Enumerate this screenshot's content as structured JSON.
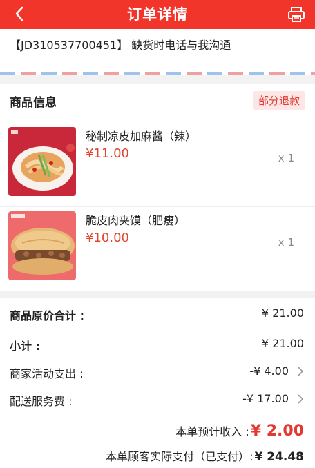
{
  "header": {
    "title": "订单详情"
  },
  "note": {
    "text": "【JD310537700451】 缺货时电话与我沟通"
  },
  "products": {
    "section_title": "商品信息",
    "refund_tag": "部分退款",
    "items": [
      {
        "name": "秘制凉皮加麻酱（辣）",
        "price": "¥11.00",
        "qty": "x 1"
      },
      {
        "name": "脆皮肉夹馍（肥瘦）",
        "price": "¥10.00",
        "qty": "x 1"
      }
    ]
  },
  "summary": {
    "original_total_label": "商品原价合计 :",
    "original_total_value": "¥ 21.00",
    "subtotal_label": "小计 :",
    "subtotal_value": "¥ 21.00",
    "promo_label": "商家活动支出 :",
    "promo_value": "-¥ 4.00",
    "delivery_label": "配送服务费 :",
    "delivery_value": "-¥ 17.00",
    "income_label": "本单预计收入 :",
    "income_value": "¥ 2.00",
    "paid_label": "本单顾客实际支付（已支付）:",
    "paid_value": "¥ 24.48"
  },
  "colors": {
    "brand_red": "#f2352b",
    "price_red": "#e0452c",
    "tag_bg": "#fde6e6"
  },
  "icons": {
    "back": "back-arrow-icon",
    "print": "printer-icon",
    "chevron": "chevron-right-icon"
  }
}
